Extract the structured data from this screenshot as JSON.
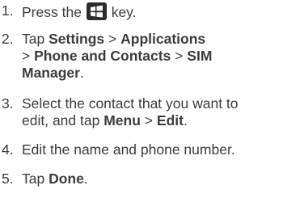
{
  "steps": [
    {
      "number": "1.",
      "parts": {
        "a": "Press the",
        "b": "key."
      }
    },
    {
      "number": "2.",
      "parts": {
        "a": "Tap",
        "b": "Settings",
        "c": ">",
        "d": "Applications",
        "e": ">",
        "f": "Phone and Contacts",
        "g": ">",
        "h": "SIM",
        "i": "Manager",
        "j": "."
      }
    },
    {
      "number": "3.",
      "parts": {
        "a": "Select the contact that you want to",
        "b": "edit, and tap",
        "c": "Menu",
        "d": ">",
        "e": "Edit",
        "f": "."
      }
    },
    {
      "number": "4.",
      "parts": {
        "a": "Edit the name and phone number."
      }
    },
    {
      "number": "5.",
      "parts": {
        "a": "Tap",
        "b": "Done",
        "c": "."
      }
    }
  ],
  "icons": {
    "start_key": "windows-start-key-icon"
  }
}
